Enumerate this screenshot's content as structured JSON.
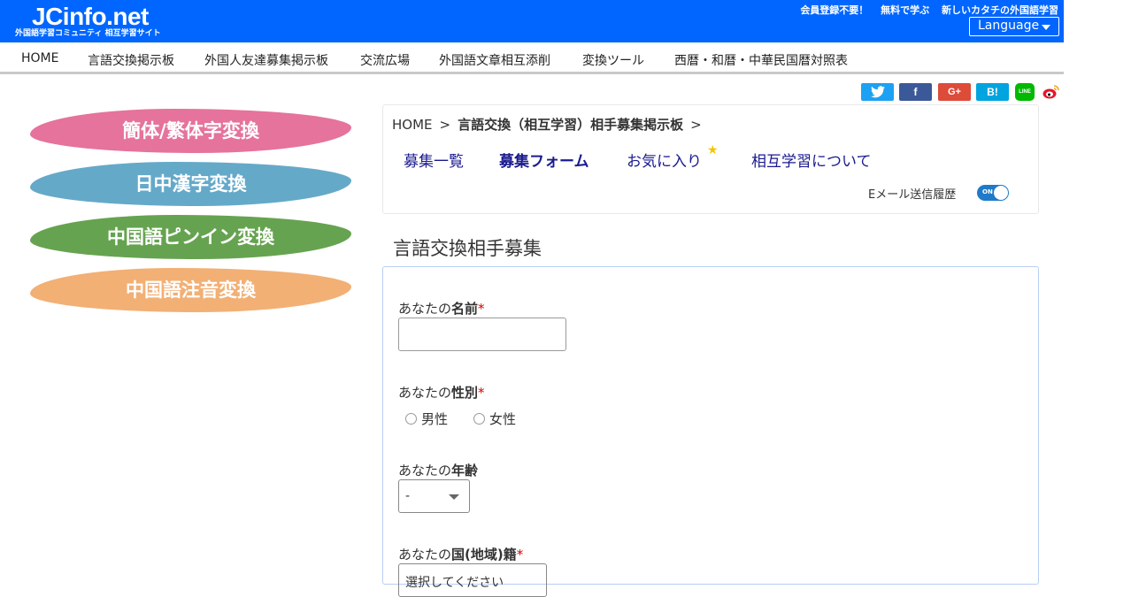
{
  "header": {
    "logo": "JCinfo.net",
    "logo_sub": "外国語学習コミュニティ 相互学習サイト",
    "tagline": [
      "会員登録不要！",
      "無料で学ぶ",
      "新しいカタチの外国語学習"
    ],
    "language_button": "Language"
  },
  "nav": [
    "HOME",
    "言語交換掲示板",
    "外国人友達募集掲示板",
    "交流広場",
    "外国語文章相互添削",
    "変換ツール",
    "西暦・和暦・中華民国暦対照表"
  ],
  "share": {
    "twitter_icon": "twitter-icon",
    "facebook": "f",
    "googleplus": "G+",
    "hatena": "B!",
    "line": "LINE",
    "weibo_icon": "weibo-icon"
  },
  "sidebar": [
    {
      "label": "簡体/繁体字変換",
      "color": "#e5739b"
    },
    {
      "label": "日中漢字変換",
      "color": "#65a9c9"
    },
    {
      "label": "中国語ピンイン変換",
      "color": "#66a350"
    },
    {
      "label": "中国語注音変換",
      "color": "#f2b075"
    }
  ],
  "breadcrumb": {
    "home": "HOME",
    "sep": ">",
    "current": "言語交換（相互学習）相手募集掲示板"
  },
  "tabs": [
    "募集一覧",
    "募集フォーム",
    "お気に入り",
    "相互学習について"
  ],
  "email_history_label": "Eメール送信履歴",
  "toggle_text": "ON",
  "form": {
    "title": "言語交換相手募集",
    "name_prefix": "あなたの",
    "name_bold": "名前",
    "gender_prefix": "あなたの",
    "gender_bold": "性別",
    "gender_options": [
      "男性",
      "女性"
    ],
    "age_prefix": "あなたの",
    "age_bold": "年齢",
    "age_value": "-",
    "country_prefix": "あなたの",
    "country_bold": "国(地域)籍",
    "country_value": "選択してください",
    "required_mark": "*"
  }
}
